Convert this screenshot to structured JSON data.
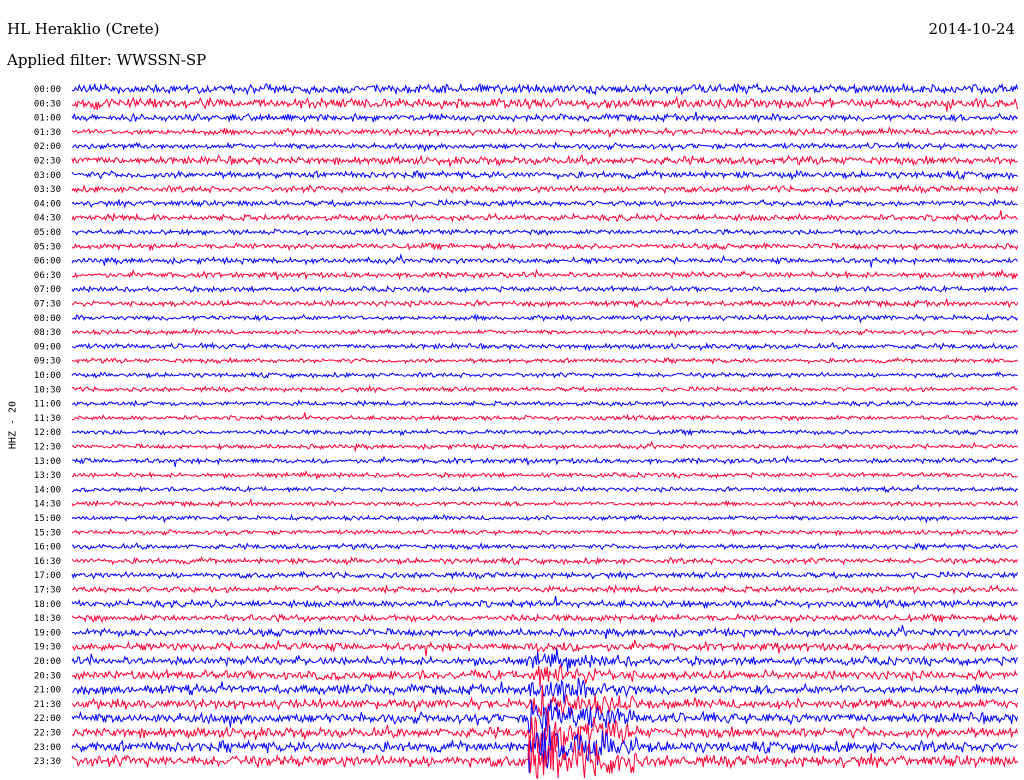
{
  "header": {
    "station": "HL Heraklio (Crete)",
    "date": "2014-10-24",
    "filter": "Applied filter: WWSSN-SP",
    "channel": "HHZ - 20"
  },
  "chart_data": {
    "type": "line",
    "ylabel": "HHZ - 20",
    "row_labels": [
      "00:00",
      "00:30",
      "01:00",
      "01:30",
      "02:00",
      "02:30",
      "03:00",
      "03:30",
      "04:00",
      "04:30",
      "05:00",
      "05:30",
      "06:00",
      "06:30",
      "07:00",
      "07:30",
      "08:00",
      "08:30",
      "09:00",
      "09:30",
      "10:00",
      "10:30",
      "11:00",
      "11:30",
      "12:00",
      "12:30",
      "13:00",
      "13:30",
      "14:00",
      "14:30",
      "15:00",
      "15:30",
      "16:00",
      "16:30",
      "17:00",
      "17:30",
      "18:00",
      "18:30",
      "19:00",
      "19:30",
      "20:00",
      "20:30",
      "21:00",
      "21:30",
      "22:00",
      "22:30",
      "23:00",
      "23:30"
    ],
    "colors": [
      "#0000ff",
      "#ff0033"
    ],
    "row_amplitude": [
      0.8,
      0.85,
      0.6,
      0.55,
      0.5,
      0.7,
      0.6,
      0.55,
      0.5,
      0.55,
      0.45,
      0.5,
      0.5,
      0.5,
      0.45,
      0.5,
      0.45,
      0.4,
      0.45,
      0.4,
      0.4,
      0.4,
      0.4,
      0.4,
      0.4,
      0.4,
      0.45,
      0.4,
      0.4,
      0.4,
      0.4,
      0.4,
      0.45,
      0.5,
      0.5,
      0.55,
      0.6,
      0.6,
      0.65,
      0.7,
      0.75,
      0.8,
      0.85,
      0.85,
      0.9,
      0.9,
      0.95,
      1.0
    ],
    "event": {
      "row": 39,
      "minute": 15
    }
  }
}
